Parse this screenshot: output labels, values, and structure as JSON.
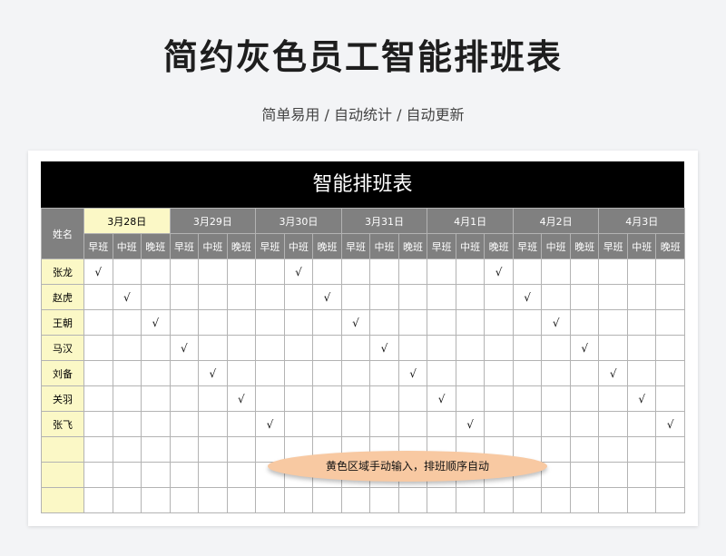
{
  "page": {
    "title": "简约灰色员工智能排班表",
    "subtitle": "简单易用  /  自动统计  /  自动更新"
  },
  "sheet": {
    "banner": "智能排班表",
    "name_header": "姓名",
    "dates": [
      "3月28日",
      "3月29日",
      "3月30日",
      "3月31日",
      "4月1日",
      "4月2日",
      "4月3日"
    ],
    "shifts": [
      "早班",
      "中班",
      "晚班"
    ],
    "check_mark": "√",
    "rows": [
      {
        "name": "张龙",
        "checks": [
          0,
          7,
          14
        ]
      },
      {
        "name": "赵虎",
        "checks": [
          1,
          8,
          15
        ]
      },
      {
        "name": "王朝",
        "checks": [
          2,
          9,
          16
        ]
      },
      {
        "name": "马汉",
        "checks": [
          3,
          10,
          17
        ]
      },
      {
        "name": "刘备",
        "checks": [
          4,
          11,
          18
        ]
      },
      {
        "name": "关羽",
        "checks": [
          5,
          12,
          19
        ]
      },
      {
        "name": "张飞",
        "checks": [
          6,
          13,
          20
        ]
      },
      {
        "name": "",
        "checks": []
      },
      {
        "name": "",
        "checks": []
      },
      {
        "name": "",
        "checks": []
      }
    ],
    "note": "黄色区域手动输入，排班顺序自动"
  },
  "colors": {
    "banner_bg": "#000000",
    "header_gray": "#808080",
    "input_yellow": "#fbf8c6",
    "note_peach": "#f8c9a2"
  }
}
